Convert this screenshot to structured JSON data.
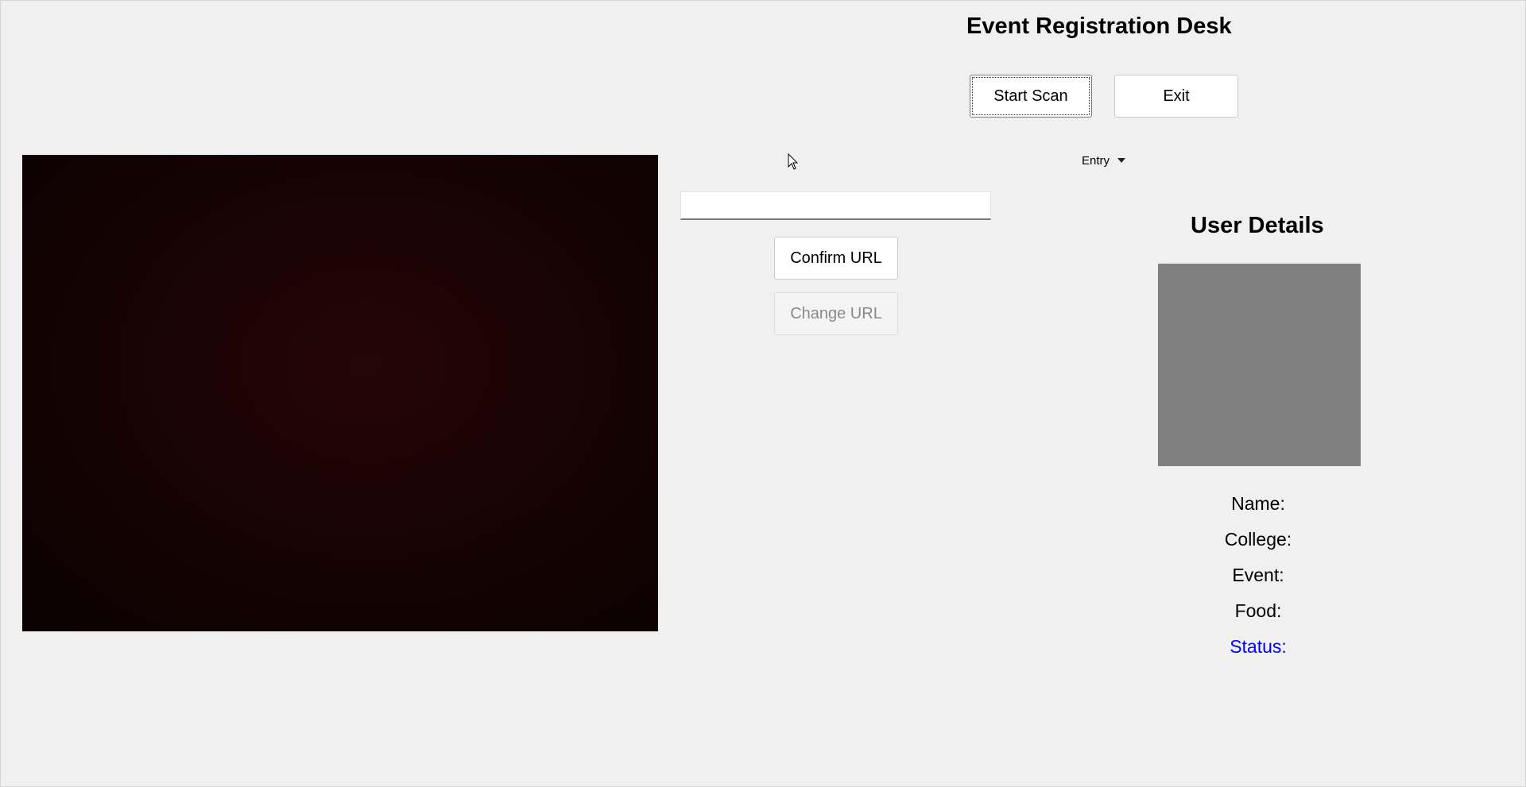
{
  "app": {
    "title": "Event Registration Desk"
  },
  "toolbar": {
    "start_scan_label": "Start Scan",
    "exit_label": "Exit"
  },
  "mode_select": {
    "selected": "Entry"
  },
  "url": {
    "value": "",
    "confirm_label": "Confirm URL",
    "change_label": "Change URL"
  },
  "details": {
    "title": "User Details",
    "name_label": "Name:",
    "college_label": "College:",
    "event_label": "Event:",
    "food_label": "Food:",
    "status_label": "Status:"
  },
  "colors": {
    "background": "#f0f0f0",
    "photo_placeholder": "#808080",
    "status_text": "#0000ff",
    "camera_feed": "#1a0303"
  },
  "icons": {
    "cursor": "mouse-pointer-icon",
    "dropdown": "caret-down-icon"
  }
}
